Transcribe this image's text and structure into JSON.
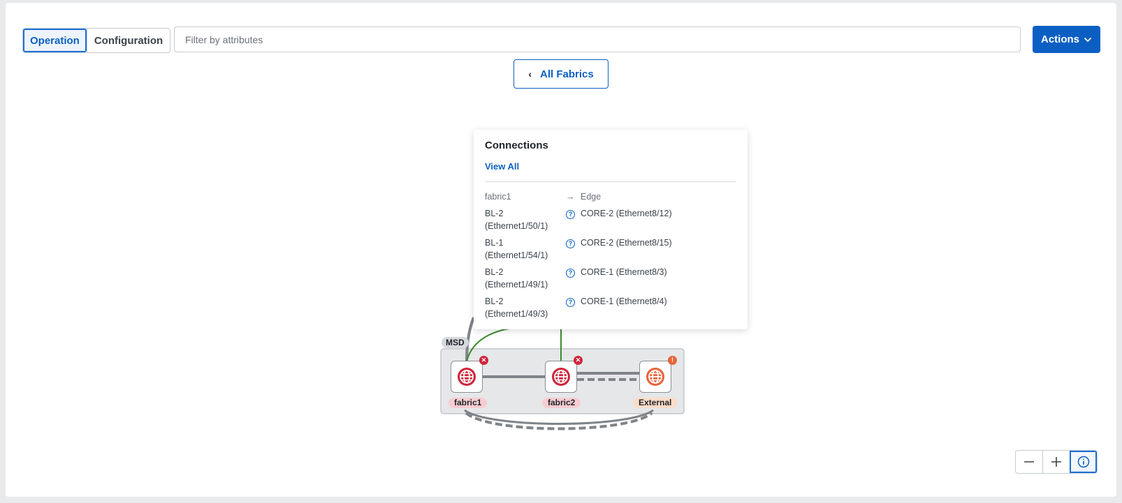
{
  "view_toggle": {
    "operation": "Operation",
    "configuration": "Configuration"
  },
  "filter": {
    "placeholder": "Filter by attributes",
    "value": ""
  },
  "actions": {
    "label": "Actions"
  },
  "back_button": {
    "label": "All Fabrics"
  },
  "topology": {
    "group_label": "MSD",
    "nodes": [
      {
        "label": "fabric1",
        "status": "error"
      },
      {
        "label": "fabric2",
        "status": "error"
      },
      {
        "label": "External",
        "status": "warning"
      }
    ]
  },
  "connections": {
    "title": "Connections",
    "view_all": "View All",
    "header": {
      "source": "fabric1",
      "target": "Edge"
    },
    "rows": [
      {
        "source_device": "BL-2",
        "source_port": "(Ethernet1/50/1)",
        "target": "CORE-2 (Ethernet8/12)"
      },
      {
        "source_device": "BL-1",
        "source_port": "(Ethernet1/54/1)",
        "target": "CORE-2 (Ethernet8/15)"
      },
      {
        "source_device": "BL-2",
        "source_port": "(Ethernet1/49/1)",
        "target": "CORE-1 (Ethernet8/3)"
      },
      {
        "source_device": "BL-2",
        "source_port": "(Ethernet1/49/3)",
        "target": "CORE-1 (Ethernet8/4)"
      }
    ]
  },
  "zoom_controls": {
    "zoom_out": "minus-icon",
    "zoom_in": "plus-icon",
    "info": "info-icon"
  },
  "colors": {
    "accent": "#0b5fc3",
    "error": "#d0243a",
    "warning": "#e8643a",
    "link_green": "#3c8a2e"
  }
}
